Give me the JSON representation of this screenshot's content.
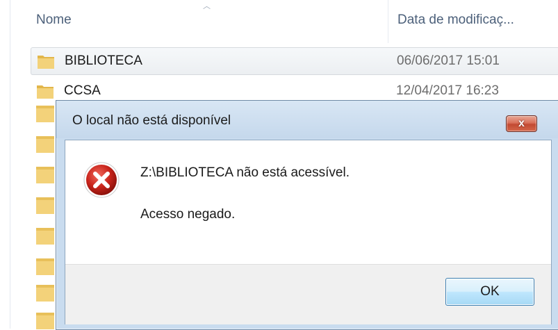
{
  "explorer": {
    "columns": {
      "name": "Nome",
      "date": "Data de modificaç..."
    },
    "rows": [
      {
        "name": "BIBLIOTECA",
        "date": "06/06/2017 15:01",
        "selected": true
      },
      {
        "name": "CCSA",
        "date": "12/04/2017 16:23",
        "selected": false
      }
    ]
  },
  "dialog": {
    "title": "O local não está disponível",
    "close_label": "x",
    "message": "Z:\\BIBLIOTECA não está acessível.",
    "detail": "Acesso negado.",
    "ok_label": "OK",
    "icon": "error-icon"
  },
  "colors": {
    "folder": "#e8c05a",
    "error": "#c8241b",
    "dialog_frame": "#c9dcef",
    "close_button": "#c24a32"
  }
}
